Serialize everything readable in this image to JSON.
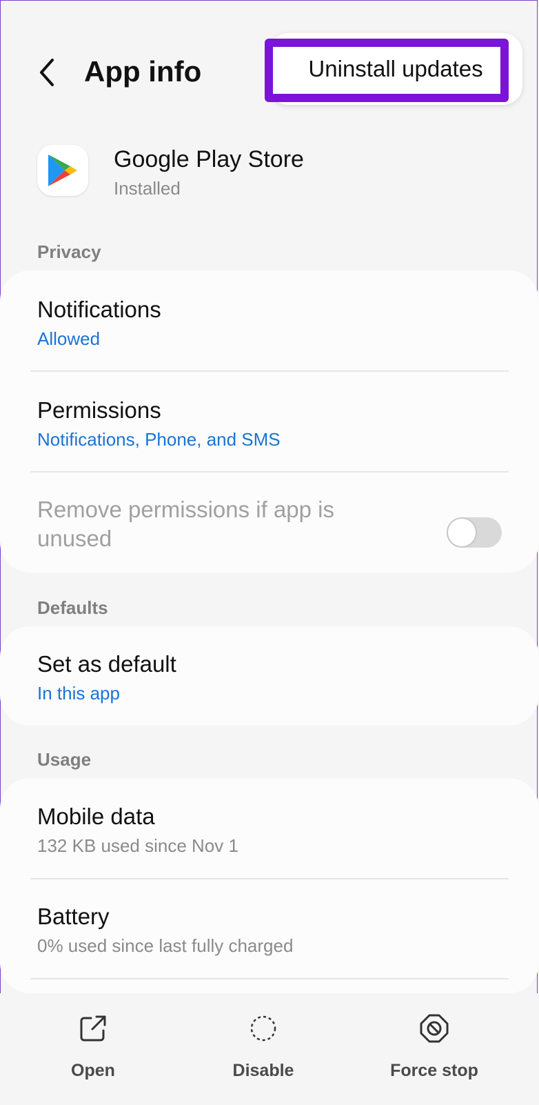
{
  "header": {
    "title": "App info",
    "back_icon": "chevron-left-icon",
    "menu": {
      "uninstall_label": "Uninstall updates"
    }
  },
  "app": {
    "name": "Google Play Store",
    "status": "Installed",
    "icon": "google-play-icon"
  },
  "sections": {
    "privacy": "Privacy",
    "defaults": "Defaults",
    "usage": "Usage"
  },
  "privacy": {
    "notifications": {
      "title": "Notifications",
      "value": "Allowed"
    },
    "permissions": {
      "title": "Permissions",
      "value": "Notifications, Phone, and SMS"
    },
    "remove_unused": {
      "title": "Remove permissions if app is unused",
      "enabled": false
    }
  },
  "defaults": {
    "set_default": {
      "title": "Set as default",
      "value": "In this app"
    }
  },
  "usage": {
    "mobile_data": {
      "title": "Mobile data",
      "value": "132 KB used since Nov 1"
    },
    "battery": {
      "title": "Battery",
      "value": "0% used since last fully charged"
    }
  },
  "bottom_actions": {
    "open": "Open",
    "disable": "Disable",
    "force_stop": "Force stop"
  },
  "colors": {
    "accent_blue": "#1a73d6",
    "highlight_purple": "#7a14d9",
    "background": "#f5f5f5",
    "card": "#fcfcfc"
  }
}
